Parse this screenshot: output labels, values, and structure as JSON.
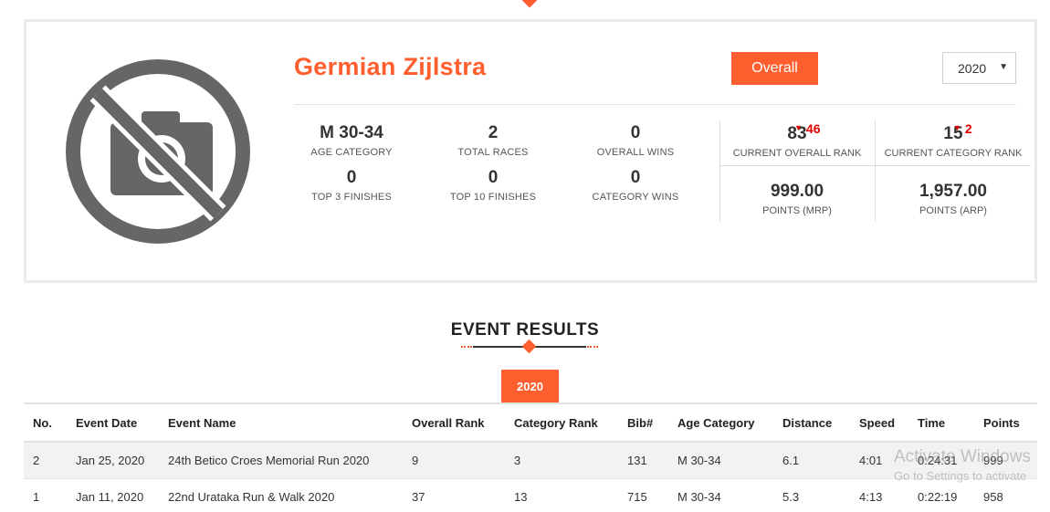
{
  "profile": {
    "name": "Germian Zijlstra",
    "overall_button": "Overall",
    "year_selected": "2020",
    "stats": [
      {
        "value": "M 30-34",
        "label": "AGE CATEGORY"
      },
      {
        "value": "2",
        "label": "TOTAL RACES"
      },
      {
        "value": "0",
        "label": "OVERALL WINS"
      },
      {
        "value": "0",
        "label": "TOP 3 FINISHES"
      },
      {
        "value": "0",
        "label": "TOP 10 FINISHES"
      },
      {
        "value": "0",
        "label": "CATEGORY WINS"
      }
    ],
    "ranks": {
      "overall_rank": {
        "value": "83",
        "delta": "46",
        "label": "CURRENT OVERALL RANK"
      },
      "category_rank": {
        "value": "15",
        "delta": "2",
        "label": "CURRENT CATEGORY RANK"
      },
      "points_mrp": {
        "value": "999.00",
        "label": "POINTS (MRP)"
      },
      "points_arp": {
        "value": "1,957.00",
        "label": "POINTS (ARP)"
      }
    },
    "avatar_icon": "no-camera-icon"
  },
  "event_results": {
    "title": "EVENT RESULTS",
    "year_tab": "2020",
    "columns": [
      "No.",
      "Event Date",
      "Event Name",
      "Overall Rank",
      "Category Rank",
      "Bib#",
      "Age Category",
      "Distance",
      "Speed",
      "Time",
      "Points"
    ],
    "rows": [
      {
        "no": "2",
        "date": "Jan 25, 2020",
        "event": "24th Betico Croes Memorial Run 2020",
        "overall_rank": "9",
        "category_rank": "3",
        "bib": "131",
        "age_category": "M 30-34",
        "distance": "6.1",
        "speed": "4:01",
        "time": "0:24:31",
        "points": "999"
      },
      {
        "no": "1",
        "date": "Jan 11, 2020",
        "event": "22nd Urataka Run & Walk 2020",
        "overall_rank": "37",
        "category_rank": "13",
        "bib": "715",
        "age_category": "M 30-34",
        "distance": "5.3",
        "speed": "4:13",
        "time": "0:22:19",
        "points": "958"
      }
    ]
  },
  "watermark": {
    "line1": "Activate Windows",
    "line2": "Go to Settings to activate"
  },
  "colors": {
    "accent": "#ff5f2e",
    "delta_down": "#e00000",
    "icon_gray": "#666666"
  }
}
